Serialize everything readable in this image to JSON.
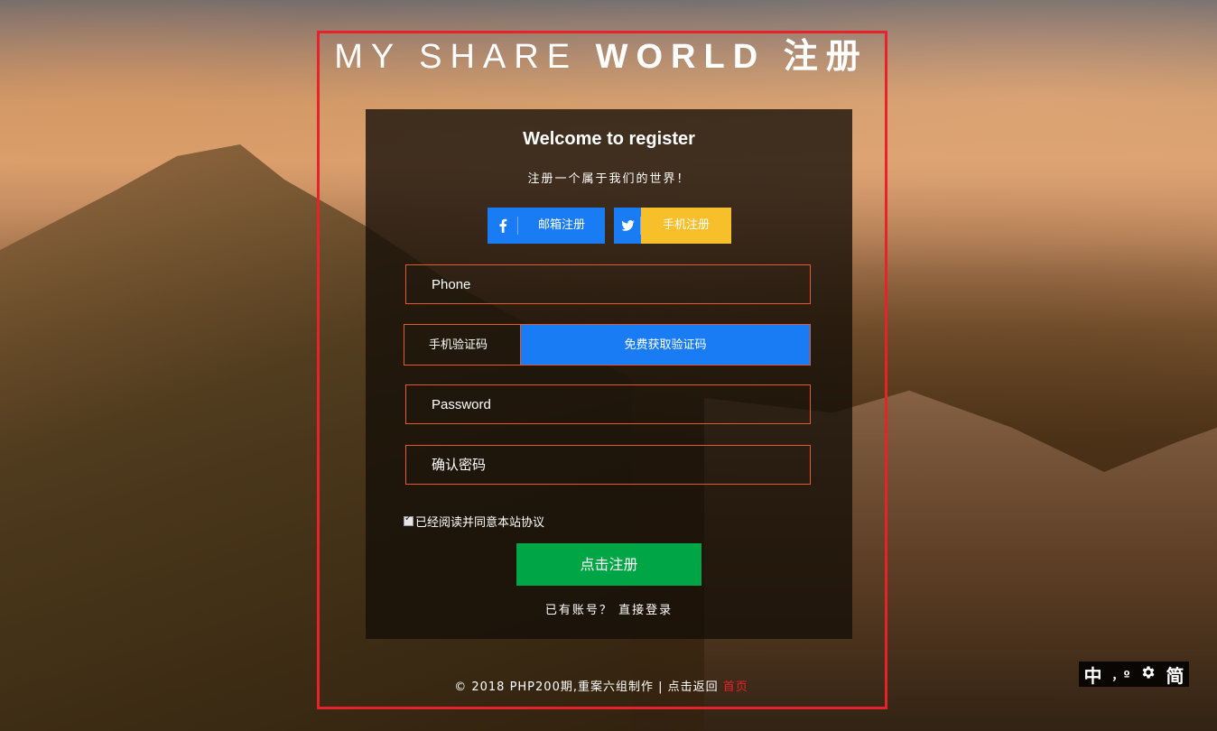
{
  "title": {
    "part_thin": "MY SHARE",
    "part_bold": "WORLD 注册"
  },
  "panel": {
    "welcome": "Welcome to register",
    "subtitle": "注册一个属于我们的世界！",
    "social": [
      {
        "label": "邮箱注册",
        "icon": "facebook-icon",
        "color": "#1a7cf5"
      },
      {
        "label": "手机注册",
        "icon": "twitter-icon",
        "color": "#f7bf2a"
      }
    ],
    "phone_placeholder": "Phone",
    "code_placeholder": "手机验证码",
    "get_code_label": "免费获取验证码",
    "password_placeholder": "Password",
    "confirm_placeholder": "确认密码",
    "agree_label": "已经阅读并同意本站协议",
    "agree_checked": true,
    "submit_label": "点击注册",
    "login_text": "已有账号？",
    "login_link": "直接登录"
  },
  "footer": {
    "text": "© 2018 PHP200期,重案六组制作 | 点击返回",
    "home_link": "首页"
  },
  "lang_tool": {
    "zh": "中",
    "small": "，º",
    "simp": "简",
    "gear_icon": "gear-icon"
  },
  "colors": {
    "frame": "#e8222b",
    "blue": "#1a7cf5",
    "yellow": "#f7bf2a",
    "green": "#00a645",
    "field_border": "#e8582b"
  }
}
